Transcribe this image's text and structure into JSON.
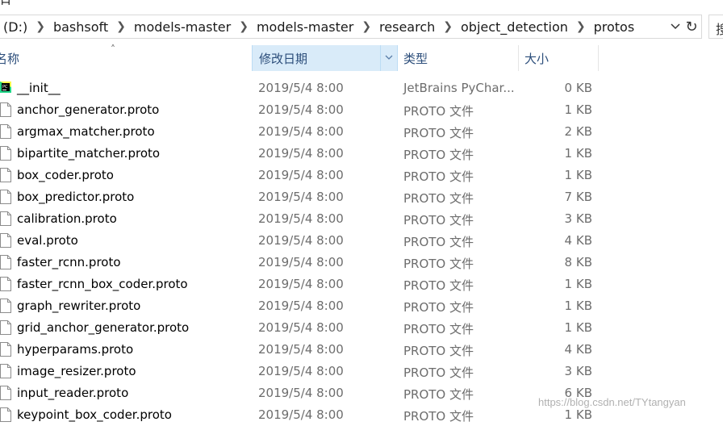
{
  "top_fragment": "目",
  "breadcrumb": [
    "(D:)",
    "bashsoft",
    "models-master",
    "models-master",
    "research",
    "object_detection",
    "protos"
  ],
  "search_fragment": "搜",
  "columns": {
    "name": "名称",
    "date": "修改日期",
    "type": "类型",
    "size": "大小"
  },
  "files": [
    {
      "name": "__init__",
      "date": "2019/5/4 8:00",
      "type": "JetBrains PyChar...",
      "size": "0 KB",
      "icon": "pycharm-icon"
    },
    {
      "name": "anchor_generator.proto",
      "date": "2019/5/4 8:00",
      "type": "PROTO 文件",
      "size": "1 KB",
      "icon": "file-icon"
    },
    {
      "name": "argmax_matcher.proto",
      "date": "2019/5/4 8:00",
      "type": "PROTO 文件",
      "size": "2 KB",
      "icon": "file-icon"
    },
    {
      "name": "bipartite_matcher.proto",
      "date": "2019/5/4 8:00",
      "type": "PROTO 文件",
      "size": "1 KB",
      "icon": "file-icon"
    },
    {
      "name": "box_coder.proto",
      "date": "2019/5/4 8:00",
      "type": "PROTO 文件",
      "size": "1 KB",
      "icon": "file-icon"
    },
    {
      "name": "box_predictor.proto",
      "date": "2019/5/4 8:00",
      "type": "PROTO 文件",
      "size": "7 KB",
      "icon": "file-icon"
    },
    {
      "name": "calibration.proto",
      "date": "2019/5/4 8:00",
      "type": "PROTO 文件",
      "size": "3 KB",
      "icon": "file-icon"
    },
    {
      "name": "eval.proto",
      "date": "2019/5/4 8:00",
      "type": "PROTO 文件",
      "size": "4 KB",
      "icon": "file-icon"
    },
    {
      "name": "faster_rcnn.proto",
      "date": "2019/5/4 8:00",
      "type": "PROTO 文件",
      "size": "8 KB",
      "icon": "file-icon"
    },
    {
      "name": "faster_rcnn_box_coder.proto",
      "date": "2019/5/4 8:00",
      "type": "PROTO 文件",
      "size": "1 KB",
      "icon": "file-icon"
    },
    {
      "name": "graph_rewriter.proto",
      "date": "2019/5/4 8:00",
      "type": "PROTO 文件",
      "size": "1 KB",
      "icon": "file-icon"
    },
    {
      "name": "grid_anchor_generator.proto",
      "date": "2019/5/4 8:00",
      "type": "PROTO 文件",
      "size": "1 KB",
      "icon": "file-icon"
    },
    {
      "name": "hyperparams.proto",
      "date": "2019/5/4 8:00",
      "type": "PROTO 文件",
      "size": "4 KB",
      "icon": "file-icon"
    },
    {
      "name": "image_resizer.proto",
      "date": "2019/5/4 8:00",
      "type": "PROTO 文件",
      "size": "3 KB",
      "icon": "file-icon"
    },
    {
      "name": "input_reader.proto",
      "date": "2019/5/4 8:00",
      "type": "PROTO 文件",
      "size": "6 KB",
      "icon": "file-icon"
    },
    {
      "name": "keypoint_box_coder.proto",
      "date": "2019/5/4 8:00",
      "type": "PROTO 文件",
      "size": "1 KB",
      "icon": "file-icon"
    }
  ],
  "watermark": "https://blog.csdn.net/TYtangyan",
  "colors": {
    "header_text": "#2b4d7a",
    "sorted_column_bg": "#d9ebf9",
    "detail_text": "#6d6d6d"
  }
}
